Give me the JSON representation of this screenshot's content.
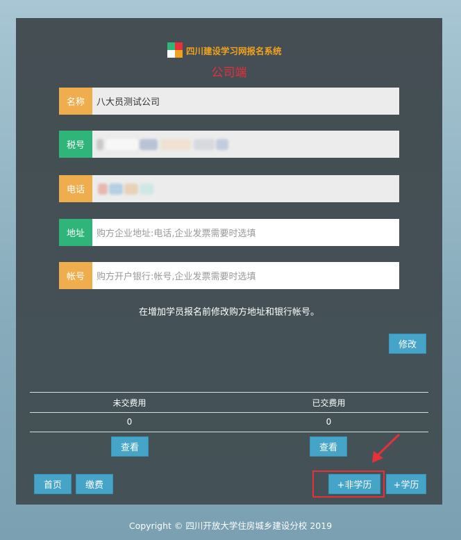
{
  "header": {
    "system_name": "四川建设学习网报名系统",
    "portal_name": "公司端",
    "logo_colors": [
      "#2fb57a",
      "#e8303a",
      "#ffffff",
      "#f0a21e"
    ]
  },
  "form": {
    "name": {
      "label": "名称",
      "value": "八大员测试公司"
    },
    "tax_id": {
      "label": "税号",
      "value": ""
    },
    "phone": {
      "label": "电话",
      "value": ""
    },
    "address": {
      "label": "地址",
      "value": "",
      "placeholder": "购方企业地址:电话,企业发票需要时选填"
    },
    "account": {
      "label": "帐号",
      "value": "",
      "placeholder": "购方开户银行:帐号,企业发票需要时选填"
    }
  },
  "note": "在增加学员报名前修改购方地址和银行帐号。",
  "modify_label": "修改",
  "fees": {
    "unpaid_label": "未交费用",
    "paid_label": "已交费用",
    "unpaid_value": "0",
    "paid_value": "0",
    "view_label": "查看"
  },
  "bottom": {
    "home_label": "首页",
    "pay_label": "缴费",
    "non_degree_label": "+非学历",
    "degree_label": "+学历"
  },
  "footer": "Copyright © 四川开放大学住房城乡建设分校 2019"
}
